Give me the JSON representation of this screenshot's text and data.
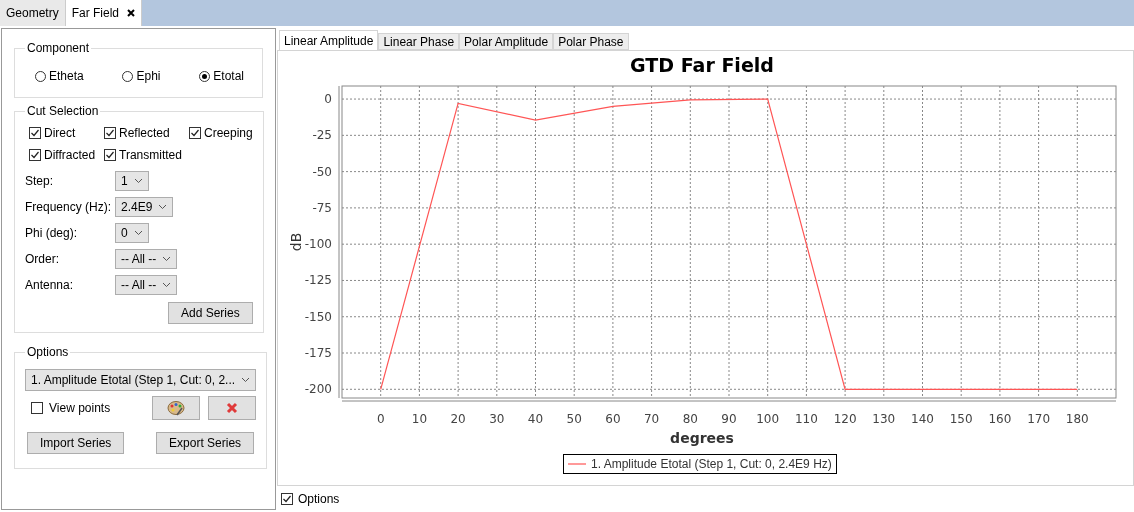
{
  "tabs": [
    {
      "label": "Geometry",
      "selected": false,
      "closable": false
    },
    {
      "label": "Far Field",
      "selected": true,
      "closable": true
    }
  ],
  "component": {
    "title": "Component",
    "options": [
      {
        "label": "Etheta",
        "selected": false
      },
      {
        "label": "Ephi",
        "selected": false
      },
      {
        "label": "Etotal",
        "selected": true
      }
    ]
  },
  "cut_selection": {
    "title": "Cut Selection",
    "checkboxes": [
      {
        "label": "Direct",
        "checked": true
      },
      {
        "label": "Reflected",
        "checked": true
      },
      {
        "label": "Creeping",
        "checked": true
      },
      {
        "label": "Diffracted",
        "checked": true
      },
      {
        "label": "Transmitted",
        "checked": true
      }
    ],
    "fields": [
      {
        "label": "Step:",
        "value": "1"
      },
      {
        "label": "Frequency (Hz):",
        "value": "2.4E9"
      },
      {
        "label": "Phi (deg):",
        "value": "0"
      },
      {
        "label": "Order:",
        "value": "-- All --"
      },
      {
        "label": "Antenna:",
        "value": "-- All --"
      }
    ],
    "add_button": "Add Series"
  },
  "options": {
    "title": "Options",
    "series_select": "1. Amplitude Etotal (Step 1, Cut: 0, 2...",
    "view_points": {
      "label": "View points",
      "checked": false
    },
    "import_button": "Import Series",
    "export_button": "Export Series"
  },
  "plot_tabs": [
    {
      "label": "Linear Amplitude",
      "selected": true
    },
    {
      "label": "Linear Phase",
      "selected": false
    },
    {
      "label": "Polar Amplitude",
      "selected": false
    },
    {
      "label": "Polar Phase",
      "selected": false
    }
  ],
  "chart_data": {
    "type": "line",
    "title": "GTD Far Field",
    "xlabel": "degrees",
    "ylabel": "dB",
    "x": [
      0,
      20,
      40,
      60,
      80,
      100,
      120,
      180
    ],
    "series": [
      {
        "name": "1. Amplitude Etotal (Step 1, Cut: 0, 2.4E9 Hz)",
        "color": "#ff5555",
        "values": [
          -200,
          -3,
          -14.5,
          -5,
          -0.5,
          0,
          -200,
          -200
        ]
      }
    ],
    "xlim": [
      -10,
      190
    ],
    "ylim": [
      -206,
      9
    ],
    "xticks": [
      0,
      10,
      20,
      30,
      40,
      50,
      60,
      70,
      80,
      90,
      100,
      110,
      120,
      130,
      140,
      150,
      160,
      170,
      180
    ],
    "yticks": [
      0,
      -25,
      -50,
      -75,
      -100,
      -125,
      -150,
      -175,
      -200
    ],
    "grid": true
  },
  "options_toggle": {
    "label": "Options",
    "checked": true
  }
}
